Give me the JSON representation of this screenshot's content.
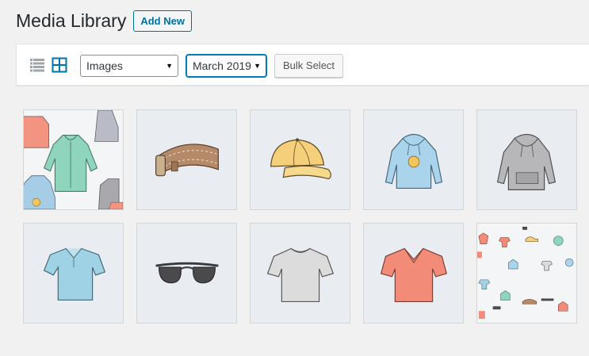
{
  "header": {
    "title": "Media Library",
    "add_new_label": "Add New"
  },
  "toolbar": {
    "list_view_icon": "list-view-icon",
    "grid_view_icon": "grid-view-icon",
    "type_filter": {
      "selected": "Images"
    },
    "date_filter": {
      "selected": "March 2019"
    },
    "bulk_select_label": "Bulk Select"
  },
  "media_items": [
    {
      "name": "hoodies-pattern"
    },
    {
      "name": "belt"
    },
    {
      "name": "cap"
    },
    {
      "name": "hoodie-with-logo"
    },
    {
      "name": "hoodie-gray"
    },
    {
      "name": "polo"
    },
    {
      "name": "sunglasses"
    },
    {
      "name": "tshirt-gray"
    },
    {
      "name": "vneck-tee"
    },
    {
      "name": "pattern-accessories"
    }
  ]
}
